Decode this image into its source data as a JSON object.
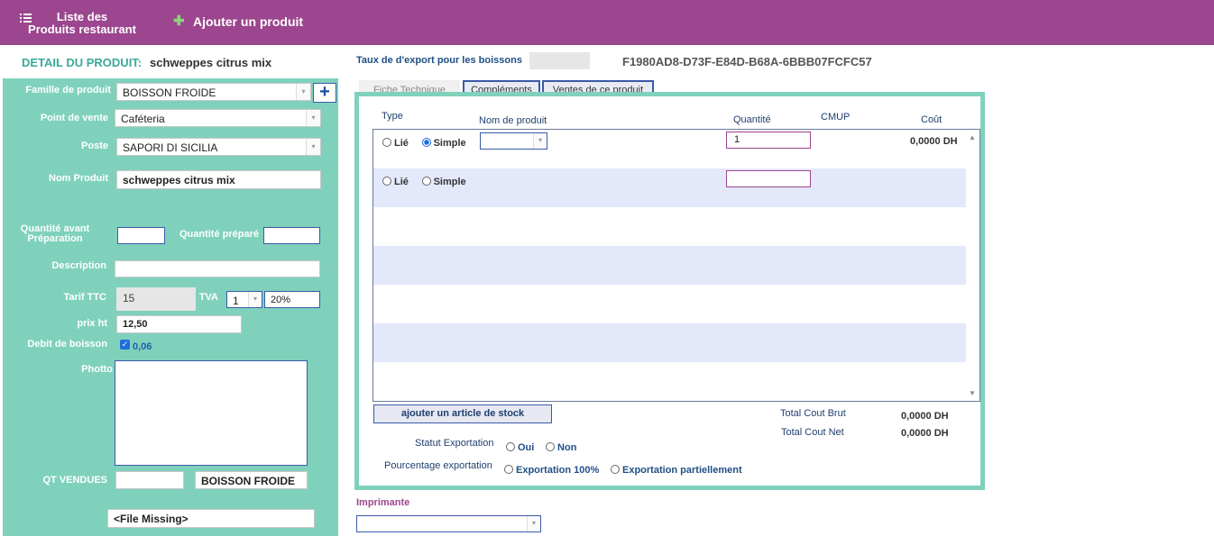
{
  "nav": {
    "list_label": "Liste des\nProduits restaurant",
    "add_label": "Ajouter un produit"
  },
  "detail": {
    "title": "DETAIL DU PRODUIT:",
    "product_name": "schweppes citrus mix"
  },
  "form": {
    "famille_label": "Famille  de produit",
    "famille_value": "BOISSON FROIDE",
    "point_vente_label": "Point de vente",
    "point_vente_value": "Caféteria",
    "poste_label": "Poste",
    "poste_value": "SAPORI DI SICILIA",
    "nom_label": "Nom Produit",
    "nom_value": "schweppes citrus mix",
    "qte_avant_label": "Quantité avant Préparation",
    "qte_avant_value": "",
    "qte_prep_label": "Quantité préparé",
    "qte_prep_value": "",
    "description_label": "Description",
    "description_value": "",
    "tarif_label": "Tarif TTC",
    "tarif_value": "15",
    "tva_label": "TVA",
    "tva_select": "1",
    "tva_rate": "20%",
    "prix_label": "prix ht",
    "prix_value": "12,50",
    "debit_label": "Debit de boisson",
    "debit_value": "0,06",
    "debit_checked": true,
    "photo_label": "Photto",
    "qt_vendues_label": "QT VENDUES",
    "qt_vendues_value": "",
    "qt_famille": "BOISSON FROIDE",
    "file_missing": "<File Missing>"
  },
  "export": {
    "label": "Taux de d'export pour les boissons",
    "value": "",
    "guid": "F1980AD8-D73F-E84D-B68A-6BBB07FCFC57"
  },
  "tabs": [
    {
      "label": "Fiche Technique",
      "active": true
    },
    {
      "label": "Compléments",
      "active": false
    },
    {
      "label": "Ventes de ce produit",
      "active": false
    }
  ],
  "grid": {
    "headers": {
      "type": "Type",
      "nom": "Nom de produit",
      "quantite": "Quantité",
      "cmup": "CMUP",
      "cout": "Coût"
    },
    "radio_lie": "Lié",
    "radio_simple": "Simple",
    "rows": [
      {
        "selected": "Simple",
        "quantite": "1",
        "cout": "0,0000 DH"
      },
      {
        "selected": "",
        "quantite": "",
        "cout": ""
      }
    ]
  },
  "actions": {
    "add_stock": "ajouter un article de stock"
  },
  "totals": {
    "brut_label": "Total Cout Brut",
    "brut_value": "0,0000 DH",
    "net_label": "Total Cout Net",
    "net_value": "0,0000 DH"
  },
  "statut": {
    "label": "Statut Exportation",
    "oui": "Oui",
    "non": "Non"
  },
  "pourcentage": {
    "label": "Pourcentage exportation",
    "opt1": "Exportation 100%",
    "opt2": "Exportation partiellement"
  },
  "printer": {
    "label": "Imprimante",
    "value": ""
  },
  "colors": {
    "header": "#9b468e",
    "panel": "#7fd1bc",
    "accent": "#3a5aa8",
    "row_alt": "#e4e8fb"
  },
  "icons": {
    "menu": "list-icon",
    "add": "plus-icon",
    "dropdown": "chevron-down-icon"
  }
}
